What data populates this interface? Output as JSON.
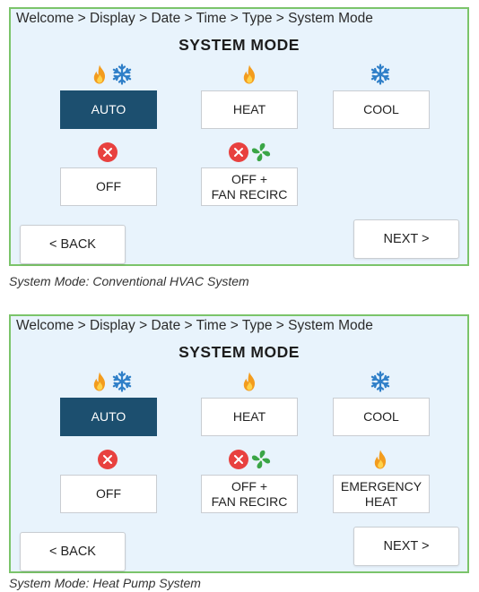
{
  "panels": [
    {
      "breadcrumb": "Welcome > Display > Date > Time > Type > System Mode",
      "title": "SYSTEM MODE",
      "buttons": {
        "auto": "AUTO",
        "heat": "HEAT",
        "cool": "COOL",
        "off": "OFF",
        "off_fan": "OFF +\nFAN RECIRC"
      },
      "selected": "AUTO",
      "back": "< BACK",
      "next": "NEXT >",
      "caption": "System Mode: Conventional HVAC System"
    },
    {
      "breadcrumb": "Welcome > Display > Date > Time > Type > System Mode",
      "title": "SYSTEM MODE",
      "buttons": {
        "auto": "AUTO",
        "heat": "HEAT",
        "cool": "COOL",
        "off": "OFF",
        "off_fan": "OFF +\nFAN RECIRC",
        "emergency": "EMERGENCY\nHEAT"
      },
      "selected": "AUTO",
      "back": "< BACK",
      "next": "NEXT >",
      "caption": "System Mode: Heat Pump System"
    }
  ],
  "colors": {
    "panel_bg": "#e8f3fc",
    "panel_border": "#7bc46a",
    "selected_bg": "#1c4f6f",
    "flame": "#f39c1e",
    "snowflake": "#2f7fc8",
    "off_red": "#e8413f",
    "fan_green": "#3aa546"
  },
  "icons": [
    "flame-icon",
    "snowflake-icon",
    "off-x-icon",
    "fan-icon"
  ]
}
